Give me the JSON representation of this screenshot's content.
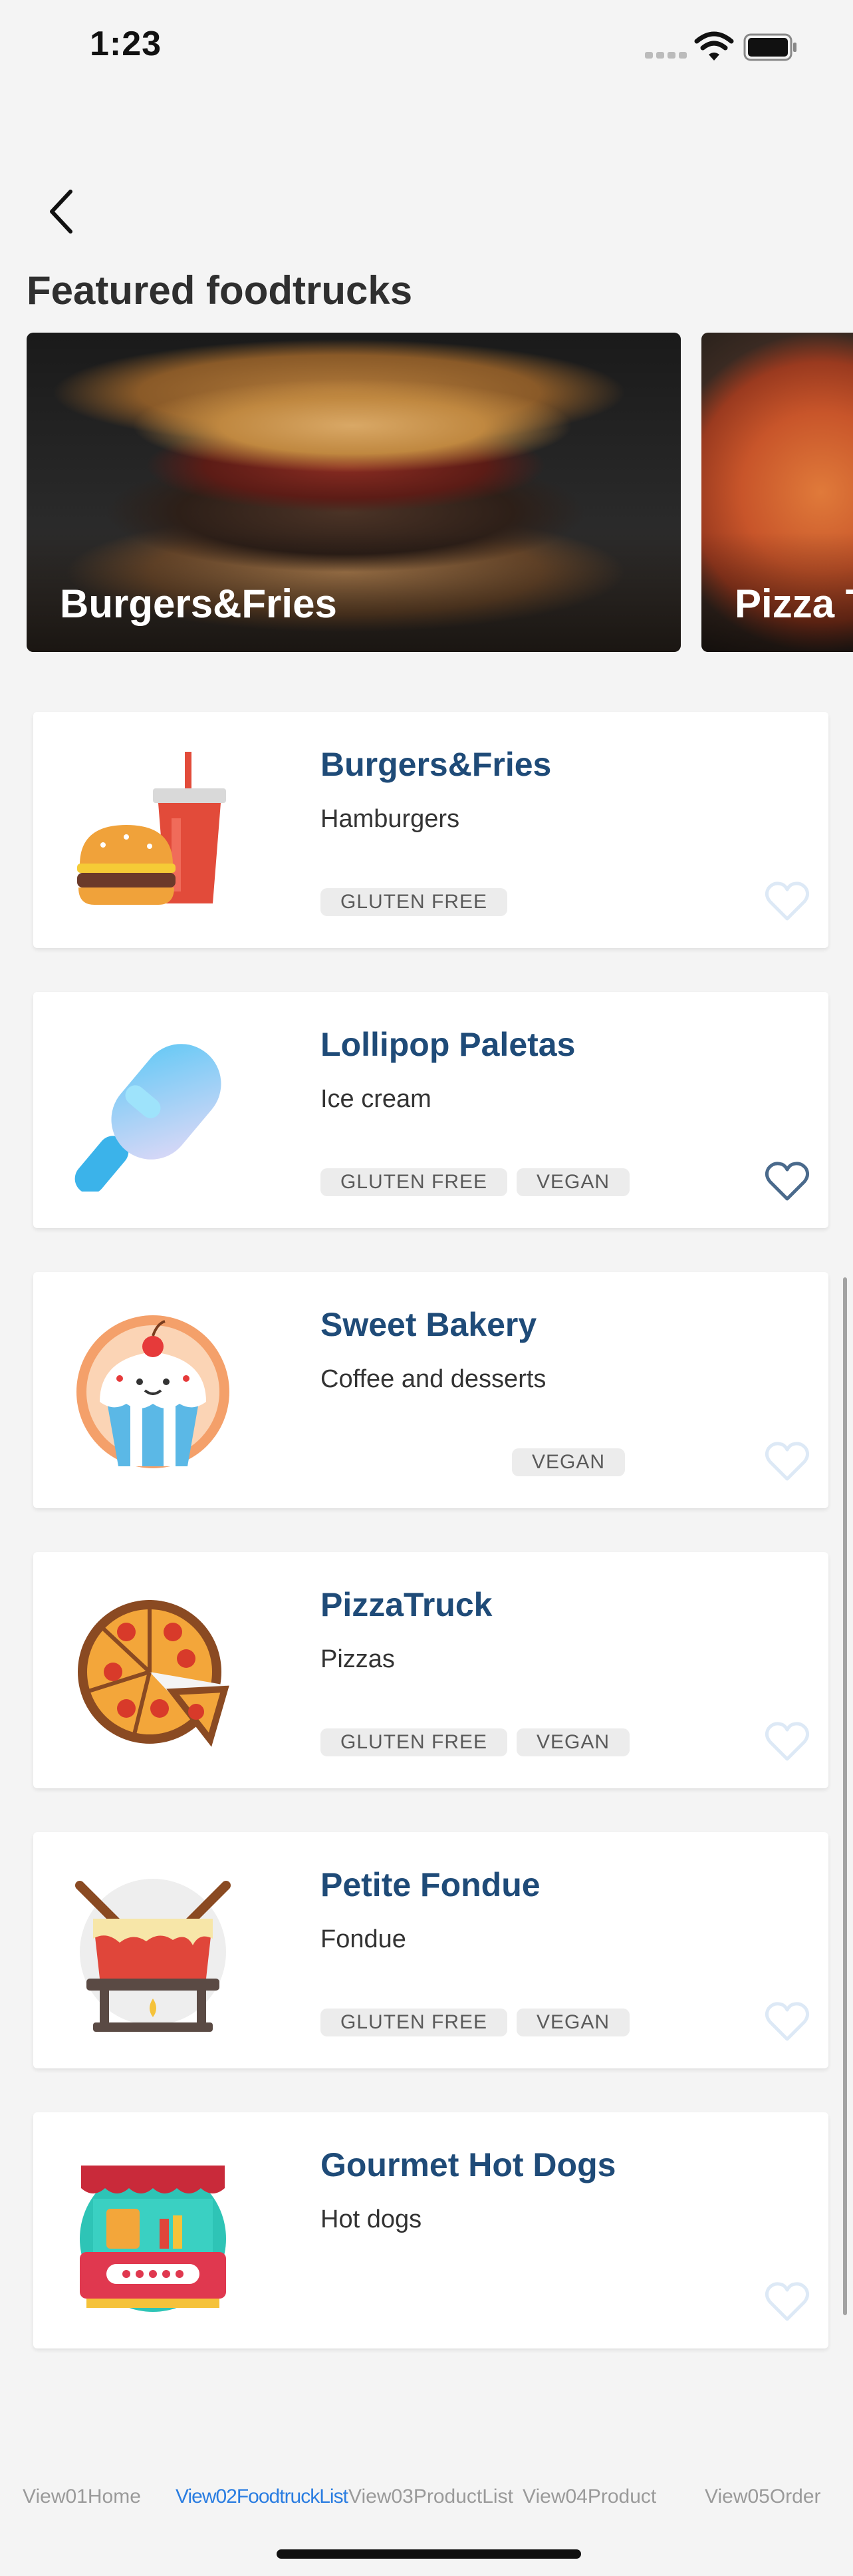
{
  "status_bar": {
    "time": "1:23"
  },
  "header": {
    "title": "Featured foodtrucks"
  },
  "featured": [
    {
      "label": "Burgers&Fries"
    },
    {
      "label": "Pizza Truck"
    }
  ],
  "trucks": [
    {
      "name": "Burgers&Fries",
      "description": "Hamburgers",
      "tags": [
        "GLUTEN FREE"
      ],
      "favorite": false
    },
    {
      "name": "Lollipop Paletas",
      "description": "Ice cream",
      "tags": [
        "GLUTEN FREE",
        "VEGAN"
      ],
      "favorite": true
    },
    {
      "name": "Sweet Bakery",
      "description": "Coffee and desserts",
      "tags": [
        "VEGAN"
      ],
      "favorite": false
    },
    {
      "name": "PizzaTruck",
      "description": "Pizzas",
      "tags": [
        "GLUTEN FREE",
        "VEGAN"
      ],
      "favorite": false
    },
    {
      "name": "Petite Fondue",
      "description": "Fondue",
      "tags": [
        "GLUTEN FREE",
        "VEGAN"
      ],
      "favorite": false
    },
    {
      "name": "Gourmet Hot Dogs",
      "description": "Hot dogs",
      "tags": [],
      "favorite": false
    }
  ],
  "tab_bar": {
    "tabs": [
      "View01Home",
      "View02FoodtruckList",
      "View03ProductList",
      "View04Product",
      "View05Order"
    ],
    "active": "View02FoodtruckList"
  },
  "colors": {
    "accent": "#2a7de1",
    "title": "#1f4b78",
    "heart_inactive": "#dde9f6",
    "heart_active": "#4a6a8c"
  }
}
